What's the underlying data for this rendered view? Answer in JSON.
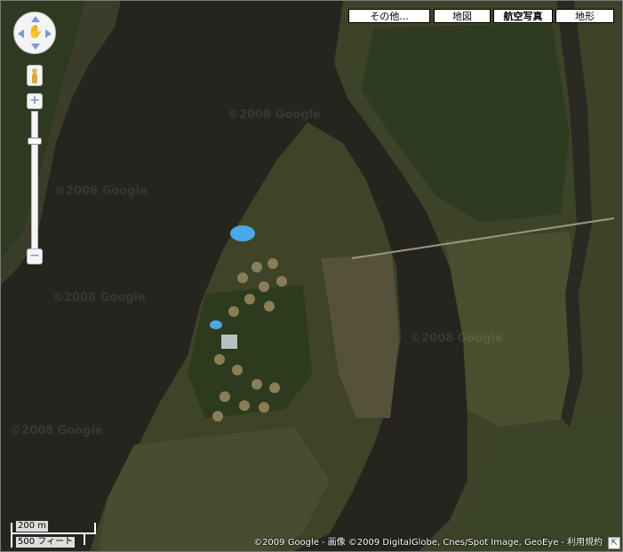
{
  "map_type_buttons": [
    {
      "id": "other",
      "label": "その他..."
    },
    {
      "id": "map",
      "label": "地図"
    },
    {
      "id": "satellite",
      "label": "航空写真",
      "active": true
    },
    {
      "id": "terrain",
      "label": "地形"
    }
  ],
  "watermark": "©2008 Google",
  "scale": {
    "metric": "200 m",
    "imperial": "500 フィート"
  },
  "copyright": {
    "google": "©2009 Google",
    "separator": "-",
    "imagery_label": "画像",
    "imagery": "©2009 DigitalGlobe, Cnes/Spot Image, GeoEye",
    "terms": "利用規約"
  },
  "zoom_slider": {
    "level_fraction": 0.2
  },
  "colors": {
    "water": "#26241f",
    "vegetation": "#3a4526",
    "field": "#4d5234",
    "pool": "#4aa8e8",
    "road": "#9b9784"
  }
}
